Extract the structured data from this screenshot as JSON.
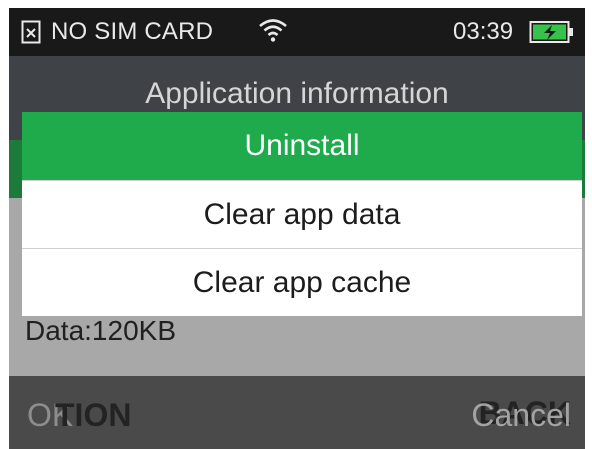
{
  "status_bar": {
    "sim_status": "NO SIM CARD",
    "time": "03:39",
    "icons": [
      "no-sim-icon",
      "wifi-icon",
      "battery-charging-icon"
    ]
  },
  "app_page": {
    "title": "Application information",
    "data_label": "Data:120KB"
  },
  "menu": {
    "items": [
      {
        "label": "Uninstall",
        "selected": true
      },
      {
        "label": "Clear app data",
        "selected": false
      },
      {
        "label": "Clear app cache",
        "selected": false
      }
    ]
  },
  "softkeys": {
    "left": "OK",
    "left_hidden": "TION",
    "right": "Cancel",
    "right_hidden": "BACK"
  },
  "colors": {
    "accent_green": "#1faa4c",
    "status_bar_bg": "#191919",
    "battery_fill": "#37c24a"
  }
}
